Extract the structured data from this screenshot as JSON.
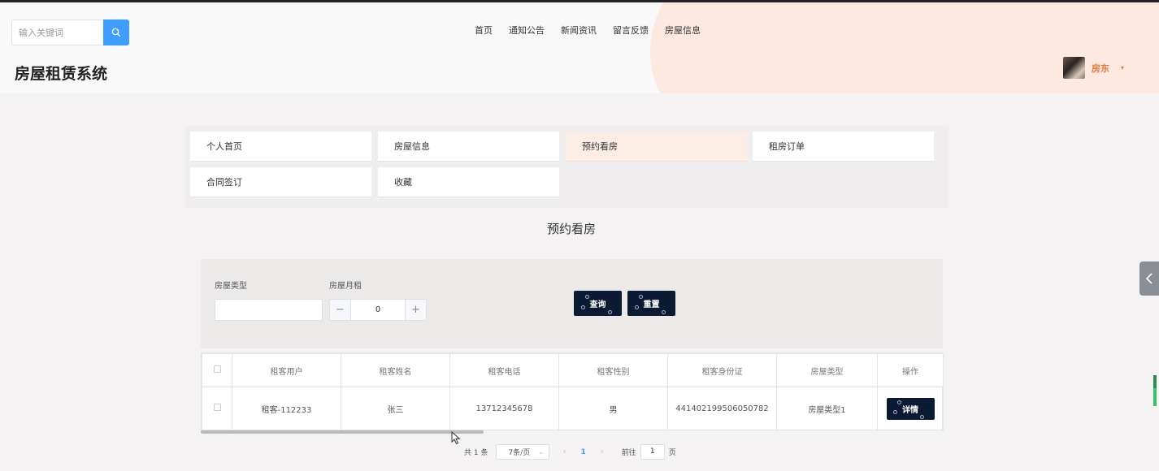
{
  "header": {
    "search": {
      "placeholder": "输入关键词",
      "icon": "search-icon"
    },
    "nav": [
      "首页",
      "通知公告",
      "新闻资讯",
      "留言反馈",
      "房屋信息"
    ],
    "site_title": "房屋租赁系统",
    "user": {
      "name": "房东",
      "caret": "▾"
    }
  },
  "menu": {
    "items": [
      "个人首页",
      "房屋信息",
      "预约看房",
      "租房订单",
      "合同签订",
      "收藏"
    ],
    "active": "预约看房"
  },
  "page_title": "预约看房",
  "filter": {
    "house_type_label": "房屋类型",
    "house_type_value": "",
    "rent_label": "房屋月租",
    "rent_value": "0",
    "minus": "−",
    "plus": "+",
    "query_button": "查询",
    "reset_button": "重置"
  },
  "table": {
    "columns": [
      "租客用户",
      "租客姓名",
      "租客电话",
      "租客性别",
      "租客身份证",
      "房屋类型",
      "操作"
    ],
    "rows": [
      {
        "user": "租客-112233",
        "name": "张三",
        "phone": "13712345678",
        "gender": "男",
        "id_card": "441402199506050782",
        "house_type": "房屋类型1",
        "action": "详情"
      }
    ]
  },
  "pagination": {
    "total": "共 1 条",
    "page_size": "7条/页",
    "prev": "‹",
    "current": "1",
    "next": "›",
    "goto_label": "前往",
    "goto_value": "1",
    "goto_suffix": "页"
  },
  "colors": {
    "accent": "#409eff",
    "dark_button": "#0b1a33",
    "user_name": "#e6793b",
    "active_menu": "#fdeee5"
  }
}
